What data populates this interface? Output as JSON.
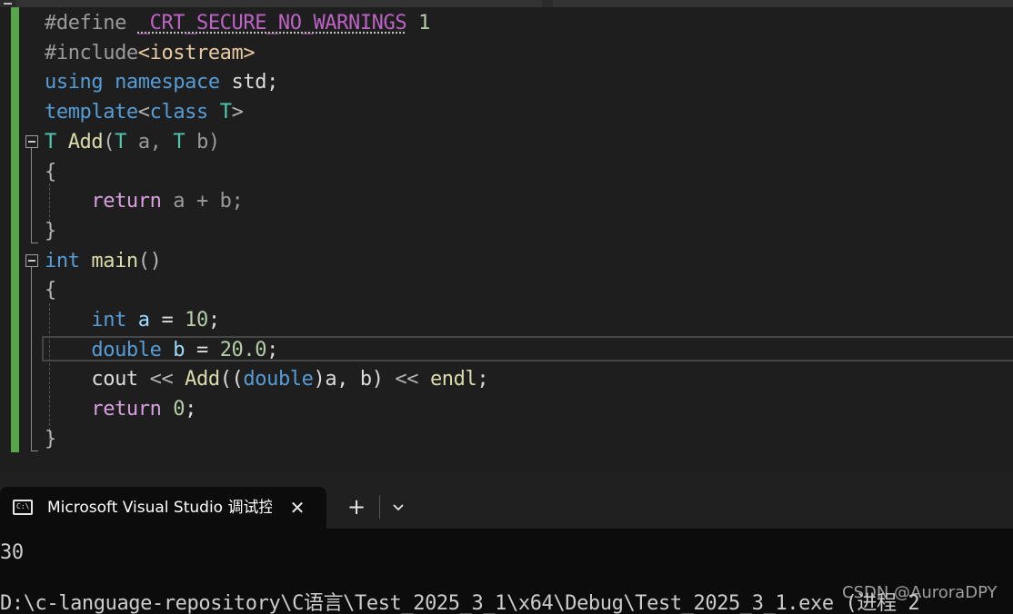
{
  "editor": {
    "lines": [
      [
        {
          "t": "#define ",
          "c": "pre"
        },
        {
          "t": "_CRT_SECURE_NO_WARNINGS",
          "c": "mac squig"
        },
        {
          "t": " ",
          "c": ""
        },
        {
          "t": "1",
          "c": "num"
        }
      ],
      [
        {
          "t": "#include",
          "c": "pre"
        },
        {
          "t": "<iostream>",
          "c": "str"
        }
      ],
      [
        {
          "t": "using ",
          "c": "kw"
        },
        {
          "t": "namespace ",
          "c": "kw"
        },
        {
          "t": "std;",
          "c": ""
        }
      ],
      [
        {
          "t": "template",
          "c": "kw"
        },
        {
          "t": "<",
          "c": "op"
        },
        {
          "t": "class ",
          "c": "kw"
        },
        {
          "t": "T",
          "c": "typ"
        },
        {
          "t": ">",
          "c": "op"
        }
      ],
      [
        {
          "t": "T ",
          "c": "typ"
        },
        {
          "t": "Add",
          "c": "fn"
        },
        {
          "t": "(",
          "c": "op"
        },
        {
          "t": "T ",
          "c": "typ"
        },
        {
          "t": "a, ",
          "c": "prm"
        },
        {
          "t": "T ",
          "c": "typ"
        },
        {
          "t": "b)",
          "c": "prm"
        }
      ],
      [
        {
          "t": "{",
          "c": "op"
        }
      ],
      [
        {
          "t": "    return ",
          "c": "ctl"
        },
        {
          "t": "a + b;",
          "c": "prm"
        }
      ],
      [
        {
          "t": "}",
          "c": "op"
        }
      ],
      [
        {
          "t": "int ",
          "c": "kw"
        },
        {
          "t": "main",
          "c": "fn"
        },
        {
          "t": "()",
          "c": "op"
        }
      ],
      [
        {
          "t": "{",
          "c": "op"
        }
      ],
      [
        {
          "t": "    int ",
          "c": "kw"
        },
        {
          "t": "a",
          "c": "var"
        },
        {
          "t": " = ",
          "c": ""
        },
        {
          "t": "10",
          "c": "num"
        },
        {
          "t": ";",
          "c": ""
        }
      ],
      [
        {
          "t": "    double ",
          "c": "kw"
        },
        {
          "t": "b",
          "c": "var"
        },
        {
          "t": " = ",
          "c": ""
        },
        {
          "t": "20.0",
          "c": "num"
        },
        {
          "t": ";",
          "c": ""
        }
      ],
      [
        {
          "t": "    cout ",
          "c": ""
        },
        {
          "t": "<< ",
          "c": "op"
        },
        {
          "t": "Add",
          "c": "fn"
        },
        {
          "t": "((",
          "c": ""
        },
        {
          "t": "double",
          "c": "kw"
        },
        {
          "t": ")a, b) ",
          "c": ""
        },
        {
          "t": "<< ",
          "c": "op"
        },
        {
          "t": "endl",
          "c": "fn"
        },
        {
          "t": ";",
          "c": ""
        }
      ],
      [
        {
          "t": "    return ",
          "c": "ctl"
        },
        {
          "t": "0",
          "c": "num"
        },
        {
          "t": ";",
          "c": ""
        }
      ],
      [
        {
          "t": "}",
          "c": "op"
        }
      ]
    ]
  },
  "terminal_tab": {
    "icon": "console-icon",
    "icon_text": "C:\\",
    "label": "Microsoft Visual Studio 调试控制台",
    "close_glyph": "✕",
    "new_tab_glyph": "+",
    "dropdown_icon": "chevron-down-icon"
  },
  "terminal": {
    "output_line": "30",
    "path_line": "D:\\c-language-repository\\C语言\\Test_2025_3_1\\x64\\Debug\\Test_2025_3_1.exe (进程 2"
  },
  "watermark": "CSDN @AuroraDPY"
}
